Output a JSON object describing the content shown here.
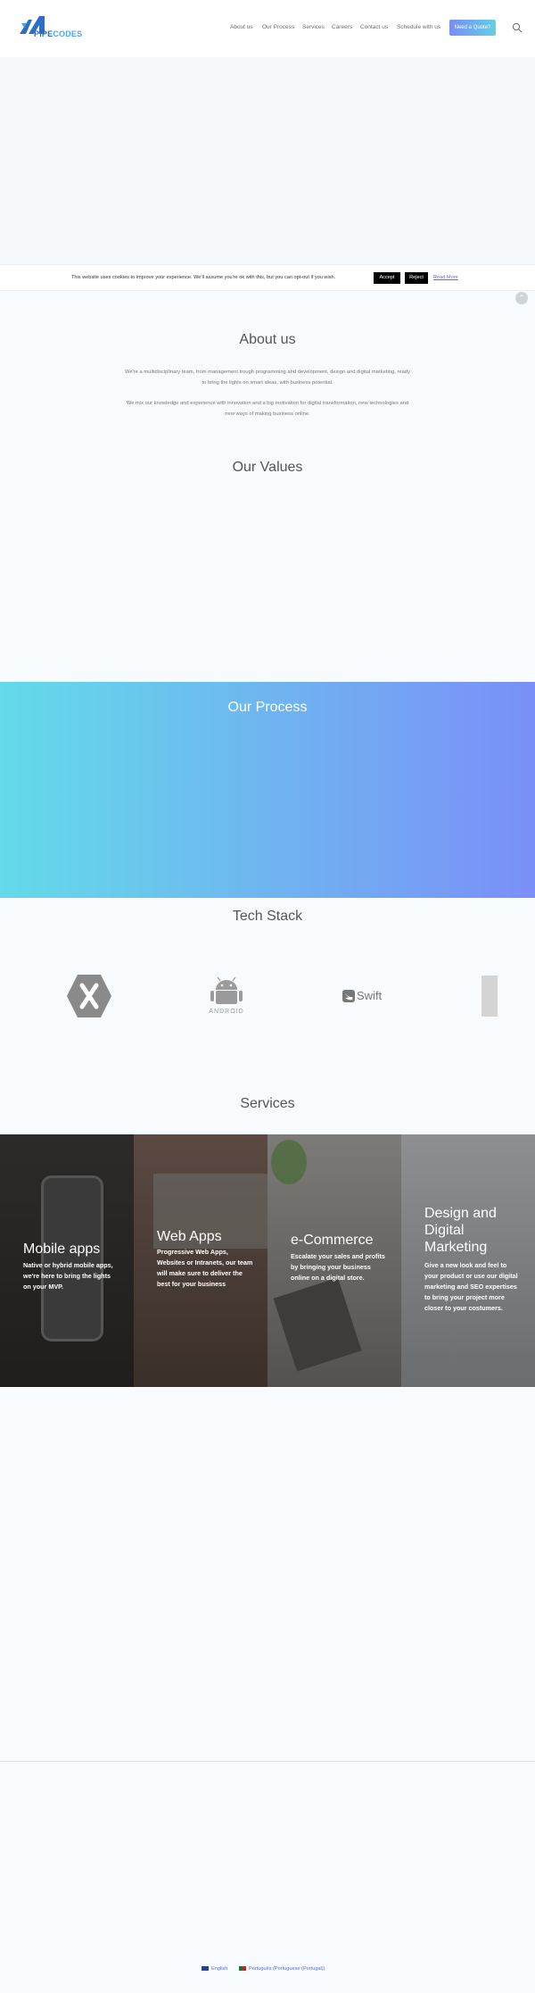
{
  "header": {
    "logo_text_part1": "PIPE",
    "logo_text_part2": "CODES",
    "nav": [
      "About us",
      "Our Process",
      "Services",
      "Careers",
      "Contact us",
      "Schedule with us"
    ],
    "cta": "Need a Quote?"
  },
  "cookie": {
    "text": "This website uses cookies to improve your experience. We'll assume you're ok with this, but you can opt-out if you wish.",
    "accept": "Accept",
    "reject": "Reject",
    "read_more": "Read More"
  },
  "about": {
    "title": "About us",
    "p1": "We're a multidisciplinary team, from management trough programming and development, design and digital marketing, ready to bring the lights on smart ideas, with business potential.",
    "p2": "We mix our knowledge and experience with innovation and a big motivation for digital transformation, new technologies and new ways of making business online."
  },
  "values": {
    "title": "Our Values"
  },
  "process": {
    "title": "Our Process"
  },
  "tech": {
    "title": "Tech Stack",
    "android_label": "ANDROID",
    "swift_label": "Swift"
  },
  "services": {
    "title": "Services",
    "tiles": [
      {
        "title": "Mobile apps",
        "desc": "Native or hybrid mobile apps, we're here to bring the lights on your MVP."
      },
      {
        "title": "Web Apps",
        "desc": "Progressive Web Apps, Websites or Intranets, our team will make sure to deliver the best for your business"
      },
      {
        "title": "e-Commerce",
        "desc": "Escalate your sales and profits by bringing your business online on a digital store."
      },
      {
        "title": "Design and Digital Marketing",
        "desc": "Give a new look and feel to your product or use our digital marketing and SEO expertises to bring your project more closer to your costumers."
      }
    ]
  },
  "languages": [
    "English",
    "Português (Portuguese (Portugal))"
  ],
  "colors": {
    "brand_blue": "#2f6cc4",
    "gradient_start": "#63dbe9",
    "gradient_end": "#7a8ff7",
    "link": "#5a6ed8"
  }
}
